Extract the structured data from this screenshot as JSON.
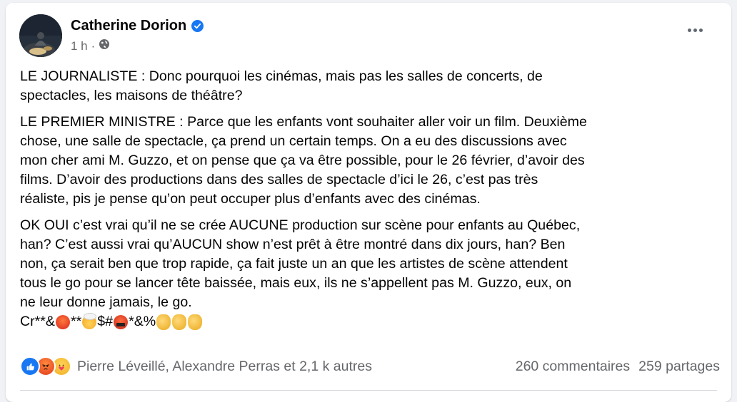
{
  "author": {
    "name": "Catherine Dorion",
    "verified": true,
    "time": "1 h",
    "privacy_icon": "globe-icon"
  },
  "post": {
    "paragraphs": [
      "LE JOURNALISTE : Donc pourquoi les cinémas, mais pas les salles de concerts, de\nspectacles, les maisons de théâtre?",
      "LE PREMIER MINISTRE : Parce que les enfants vont souhaiter aller voir un film. Deuxième\nchose, une salle de spectacle, ça prend un certain temps. On a eu des discussions avec\nmon cher ami M. Guzzo, et on pense que ça va être possible, pour le 26 février, d’avoir des\nfilms. D’avoir des productions dans des salles de spectacle d’ici le 26, c’est pas très\nréaliste, pis je pense qu’on peut occuper plus d’enfants avec des cinémas.",
      "OK OUI c’est vrai qu’il ne se crée AUCUNE production sur scène pour enfants au Québec,\nhan? C’est aussi vrai qu’AUCUN show n’est prêt à être montré dans dix jours, han? Ben\nnon, ça serait ben que trop rapide, ça fait juste un an que les artistes de scène attendent\ntous le go pour se lancer tête baissée, mais eux, ils ne s’appellent pas M. Guzzo, eux, on\nne leur donne jamais, le go."
    ],
    "emoji_line": {
      "seg1": "Cr**&",
      "seg2": "**",
      "seg3": "$#",
      "seg4": "*&%"
    }
  },
  "reactions": {
    "icons": [
      "like-icon",
      "angry-icon",
      "care-icon"
    ],
    "reactors": "Pierre Léveillé, Alexandre Perras et 2,1 k autres",
    "comments": "260 commentaires",
    "shares": "259 partages"
  },
  "colors": {
    "accent": "#1877f2",
    "secondary_text": "#65676b",
    "primary_text": "#050505"
  }
}
